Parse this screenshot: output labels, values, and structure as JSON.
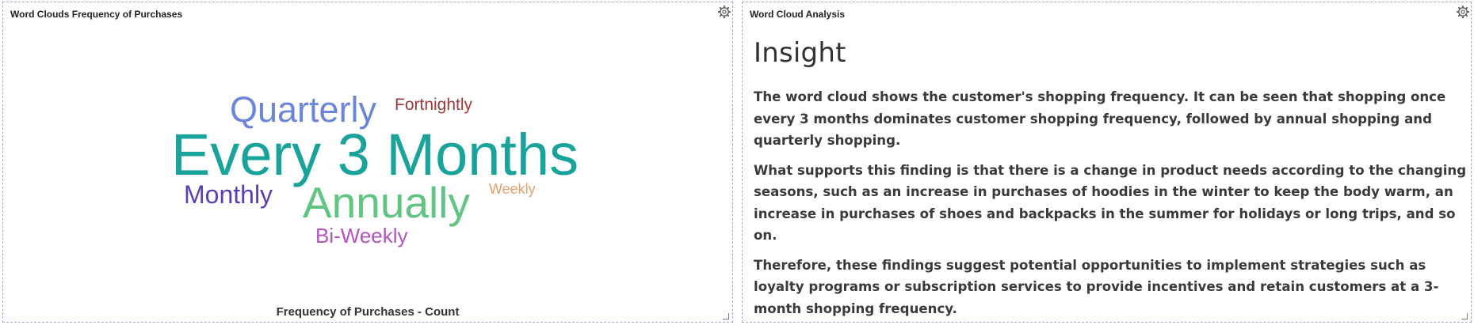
{
  "left_panel": {
    "title": "Word Clouds Frequency of Purchases",
    "caption": "Frequency of Purchases - Count",
    "words": {
      "every_3_months": {
        "text": "Every 3 Months",
        "color": "#1aa39b"
      },
      "annually": {
        "text": "Annually",
        "color": "#60c482"
      },
      "quarterly": {
        "text": "Quarterly",
        "color": "#6b86d8"
      },
      "monthly": {
        "text": "Monthly",
        "color": "#5a3fb4"
      },
      "bi_weekly": {
        "text": "Bi-Weekly",
        "color": "#b552c2"
      },
      "fortnightly": {
        "text": "Fortnightly",
        "color": "#9b3a3a"
      },
      "weekly": {
        "text": "Weekly",
        "color": "#e0a070"
      }
    },
    "icons": {
      "settings": "gear-icon",
      "resize": "resize-handle-icon"
    }
  },
  "right_panel": {
    "title": "Word Cloud Analysis",
    "heading": "Insight",
    "paragraphs": [
      "The word cloud shows the customer's shopping frequency. It can be seen that shopping once every 3 months dominates customer shopping frequency, followed by annual shopping and quarterly shopping.",
      "What supports this finding is that there is a change in product needs according to the changing seasons, such as an increase in purchases of hoodies in the winter to keep the body warm, an increase in purchases of shoes and backpacks in the summer for holidays or long trips, and so on.",
      "Therefore, these findings suggest potential opportunities to implement strategies such as loyalty programs or subscription services to provide incentives and retain customers at a 3-month shopping frequency."
    ],
    "icons": {
      "settings": "gear-icon",
      "resize": "resize-handle-icon"
    }
  }
}
